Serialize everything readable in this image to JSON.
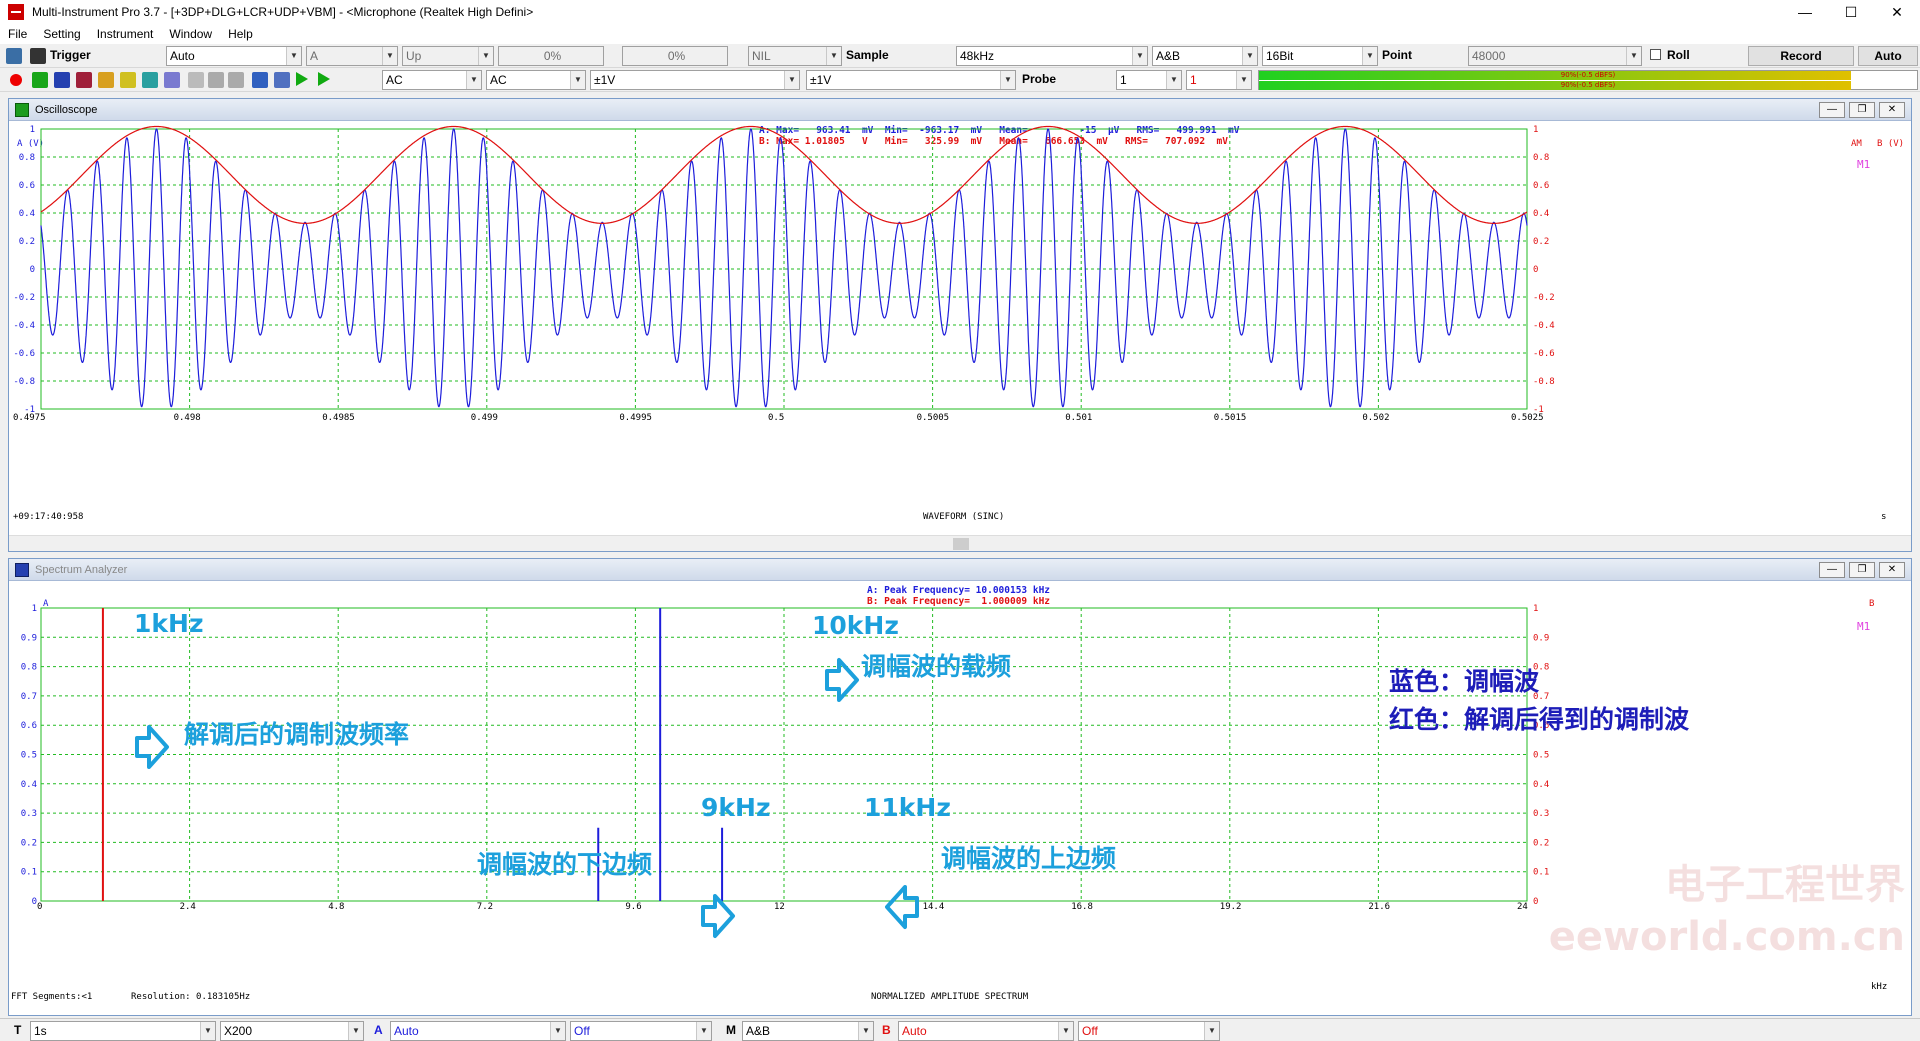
{
  "window": {
    "title": "Multi-Instrument Pro 3.7   -  [+3DP+DLG+LCR+UDP+VBM]   -  <Microphone (Realtek High Defini>",
    "min": "—",
    "max": "☐",
    "close": "✕"
  },
  "menu": [
    "File",
    "Setting",
    "Instrument",
    "Window",
    "Help"
  ],
  "toolbar1": {
    "trigger_label": "Trigger",
    "trigger_mode": "Auto",
    "trigger_channel": "A",
    "trigger_edge": "Up",
    "trigger_level": "0%",
    "trigger_pretrigger": "0%",
    "nil": "NIL",
    "sample_label": "Sample",
    "sample_rate": "48kHz",
    "channels": "A&B",
    "bits": "16Bit",
    "point_label": "Point",
    "points": "48000",
    "roll_label": "Roll",
    "record_label": "Record",
    "auto_label": "Auto"
  },
  "toolbar2": {
    "coupling_a": "AC",
    "coupling_b": "AC",
    "range_a": "±1V",
    "range_b": "±1V",
    "probe_label": "Probe",
    "probe_a": "1",
    "probe_b": "1",
    "meter_a": "90%(-0.5 dBFS)",
    "meter_b": "90%(-0.5 dBFS)",
    "meter_a_level": 0.9,
    "meter_b_level": 0.9
  },
  "oscilloscope": {
    "title": "Oscilloscope",
    "axis_a": "A  (V)",
    "axis_b": "B  (V)",
    "am_tag": "AM",
    "marker": "M1",
    "stats_a": "A: Max=   963.41  mV  Min=  -963.17  mV   Mean=         -15  μV   RMS=   499.991  mV",
    "stats_b": "B: Max= 1.01805   V   Min=   325.99  mV   Mean=   666.653  mV   RMS=   707.092  mV",
    "timestamp": "+09:17:40:958",
    "xlabel": "WAVEFORM  (SINC)",
    "xunit": "s"
  },
  "spectrum": {
    "title": "Spectrum Analyzer",
    "axis_a": "A",
    "axis_b": "B",
    "marker": "M1",
    "stats_a": "A: Peak Frequency= 10.000153 kHz",
    "stats_b": "B: Peak Frequency=  1.000009 kHz",
    "fft_segments": "FFT Segments:<1",
    "resolution": "Resolution: 0.183105Hz",
    "xlabel": "NORMALIZED AMPLITUDE SPECTRUM",
    "xunit": "kHz"
  },
  "annotations": {
    "f1k": "1kHz",
    "f10k": "10kHz",
    "f9k": "9kHz",
    "f11k": "11kHz",
    "carrier": "调幅波的载频",
    "demod": "解调后的调制波频率",
    "lower_sb": "调幅波的下边频",
    "upper_sb": "调幅波的上边频",
    "legend_blue": "蓝色：调幅波",
    "legend_red": "红色：解调后得到的调制波"
  },
  "statusbar": {
    "t_label": "T",
    "t_value": "1s",
    "zoom": "X200",
    "a_label": "A",
    "a_value": "Auto",
    "a_off": "Off",
    "m_label": "M",
    "m_value": "A&B",
    "b_label": "B",
    "b_value": "Auto",
    "b_off": "Off"
  },
  "watermark": "电子工程世界 eeworld.com.cn",
  "colors": {
    "ch_a": "#1d1ddb",
    "ch_b": "#e01010",
    "grid": "#22bb22",
    "annotation": "#1ca0dc",
    "note": "#1d1db8"
  },
  "chart_data": [
    {
      "type": "line",
      "x_ticks": [
        "0.4975",
        "0.498",
        "0.4985",
        "0.499",
        "0.4995",
        "0.5",
        "0.5005",
        "0.501",
        "0.5015",
        "0.502",
        "0.5025"
      ],
      "y_ticks": [
        "1",
        "0.8",
        "0.6",
        "0.4",
        "0.2",
        "0",
        "-0.2",
        "-0.4",
        "-0.6",
        "-0.8",
        "-1"
      ],
      "xlim": [
        0.4975,
        0.5025
      ],
      "ylim": [
        -1,
        1
      ],
      "series": [
        {
          "name": "A",
          "function": "am",
          "carrier_hz": 10000,
          "mod_hz": 1000,
          "amplitude": 1.0,
          "mod_depth": 0.5
        },
        {
          "name": "B",
          "function": "envelope",
          "mod_hz": 1000,
          "max": 1.018,
          "min": 0.326
        }
      ],
      "grid": true
    },
    {
      "type": "bar",
      "x_ticks": [
        "0",
        "2.4",
        "4.8",
        "7.2",
        "9.6",
        "12",
        "14.4",
        "16.8",
        "19.2",
        "21.6",
        "24"
      ],
      "y_ticks": [
        "1",
        "0.9",
        "0.8",
        "0.7",
        "0.6",
        "0.5",
        "0.4",
        "0.3",
        "0.2",
        "0.1",
        "0"
      ],
      "xlim": [
        0,
        24
      ],
      "ylim": [
        0,
        1
      ],
      "series": [
        {
          "name": "A",
          "x": [
            9,
            10,
            11
          ],
          "values": [
            0.25,
            1.0,
            0.25
          ]
        },
        {
          "name": "B",
          "x": [
            1
          ],
          "values": [
            1.0
          ]
        }
      ],
      "grid": true
    }
  ]
}
